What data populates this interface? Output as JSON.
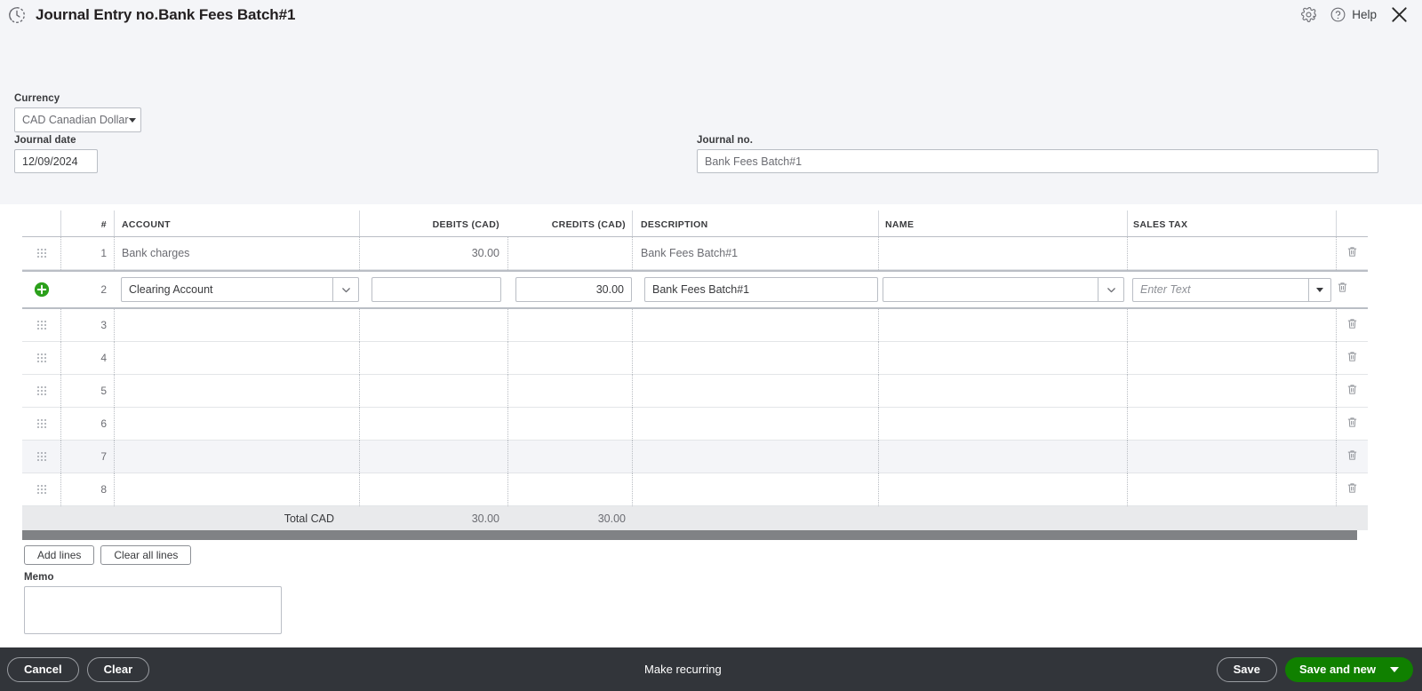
{
  "header": {
    "title": "Journal Entry no.Bank Fees Batch#1",
    "recurring_icon": "recurring-clock-icon",
    "gear_icon": "gear-icon",
    "help_icon": "help-circle-icon",
    "help_label": "Help",
    "close_icon": "close-icon"
  },
  "form": {
    "currency_label": "Currency",
    "currency_value": "CAD Canadian Dollar",
    "journal_date_label": "Journal date",
    "journal_date_value": "12/09/2024",
    "journal_no_label": "Journal no.",
    "journal_no_value": "Bank Fees Batch#1"
  },
  "grid": {
    "columns": [
      "#",
      "ACCOUNT",
      "DEBITS (CAD)",
      "CREDITS (CAD)",
      "DESCRIPTION",
      "NAME",
      "SALES TAX"
    ],
    "rows": [
      {
        "num": "1",
        "account": "Bank charges",
        "debits": "30.00",
        "credits": "",
        "description": "Bank Fees Batch#1",
        "name": "",
        "sales_tax": "",
        "state": "normal"
      },
      {
        "num": "3",
        "account": "",
        "debits": "",
        "credits": "",
        "description": "",
        "name": "",
        "sales_tax": "",
        "state": "normal"
      },
      {
        "num": "4",
        "account": "",
        "debits": "",
        "credits": "",
        "description": "",
        "name": "",
        "sales_tax": "",
        "state": "normal"
      },
      {
        "num": "5",
        "account": "",
        "debits": "",
        "credits": "",
        "description": "",
        "name": "",
        "sales_tax": "",
        "state": "normal"
      },
      {
        "num": "6",
        "account": "",
        "debits": "",
        "credits": "",
        "description": "",
        "name": "",
        "sales_tax": "",
        "state": "normal"
      },
      {
        "num": "7",
        "account": "",
        "debits": "",
        "credits": "",
        "description": "",
        "name": "",
        "sales_tax": "",
        "state": "hovered"
      },
      {
        "num": "8",
        "account": "",
        "debits": "",
        "credits": "",
        "description": "",
        "name": "",
        "sales_tax": "",
        "state": "normal"
      }
    ],
    "active_row": {
      "num": "2",
      "account": "Clearing Account",
      "debits": "",
      "credits": "30.00",
      "description": "Bank Fees Batch#1",
      "name": "",
      "sales_tax": "",
      "sales_tax_placeholder": "Enter Text",
      "add_line_icon": "add-circle-icon"
    },
    "total_label": "Total CAD",
    "total_debits": "30.00",
    "total_credits": "30.00",
    "delete_icon": "trash-icon",
    "drag_icon": "drag-handle-icon"
  },
  "actions": {
    "add_lines": "Add lines",
    "clear_all_lines": "Clear all lines",
    "memo_label": "Memo",
    "memo_value": ""
  },
  "footer": {
    "cancel": "Cancel",
    "clear": "Clear",
    "make_recurring": "Make recurring",
    "save": "Save",
    "save_and_new": "Save and new",
    "dropdown_icon": "caret-down-icon"
  },
  "colors": {
    "brand_green": "#108000",
    "footer_bg": "#32353a",
    "panel_bg": "#f4f5f8",
    "add_icon_green": "#2ca01c"
  }
}
